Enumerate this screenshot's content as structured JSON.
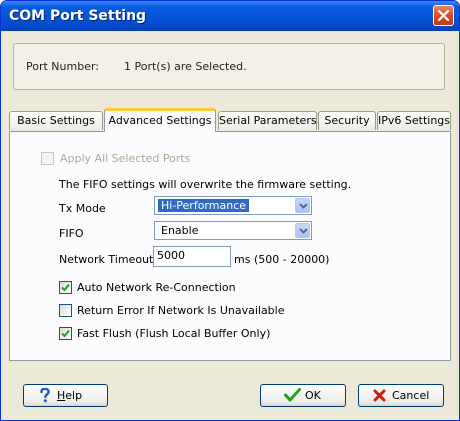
{
  "window": {
    "title": "COM Port Setting"
  },
  "port": {
    "label": "Port Number:",
    "value": "1 Port(s) are Selected."
  },
  "tabs": [
    {
      "label": "Basic Settings"
    },
    {
      "label": "Advanced Settings"
    },
    {
      "label": "Serial Parameters"
    },
    {
      "label": "Security"
    },
    {
      "label": "IPv6 Settings"
    }
  ],
  "advanced": {
    "apply_all_label": "Apply All Selected Ports",
    "fifo_note": "The FIFO settings will overwrite the firmware setting.",
    "tx_mode": {
      "label": "Tx Mode",
      "value": "Hi-Performance"
    },
    "fifo": {
      "label": "FIFO",
      "value": "Enable"
    },
    "network_timeout": {
      "label": "Network Timeout",
      "value": "5000",
      "hint": "ms (500 - 20000)"
    },
    "auto_reconnect": {
      "label": "Auto Network Re-Connection",
      "checked": true
    },
    "return_error": {
      "label": "Return Error If Network Is Unavailable",
      "checked": false
    },
    "fast_flush": {
      "label": "Fast Flush (Flush Local Buffer Only)",
      "checked": true
    }
  },
  "buttons": {
    "help": {
      "label_prefix": "",
      "mnemonic": "H",
      "label_rest": "elp"
    },
    "ok": {
      "label": "OK"
    },
    "cancel": {
      "label": "Cancel"
    }
  },
  "colors": {
    "title_bar": "#0553d8",
    "close": "#d3522d",
    "check": "#21a121",
    "cancel_x": "#c81e0a",
    "help_icon": "#1f5bc8"
  }
}
